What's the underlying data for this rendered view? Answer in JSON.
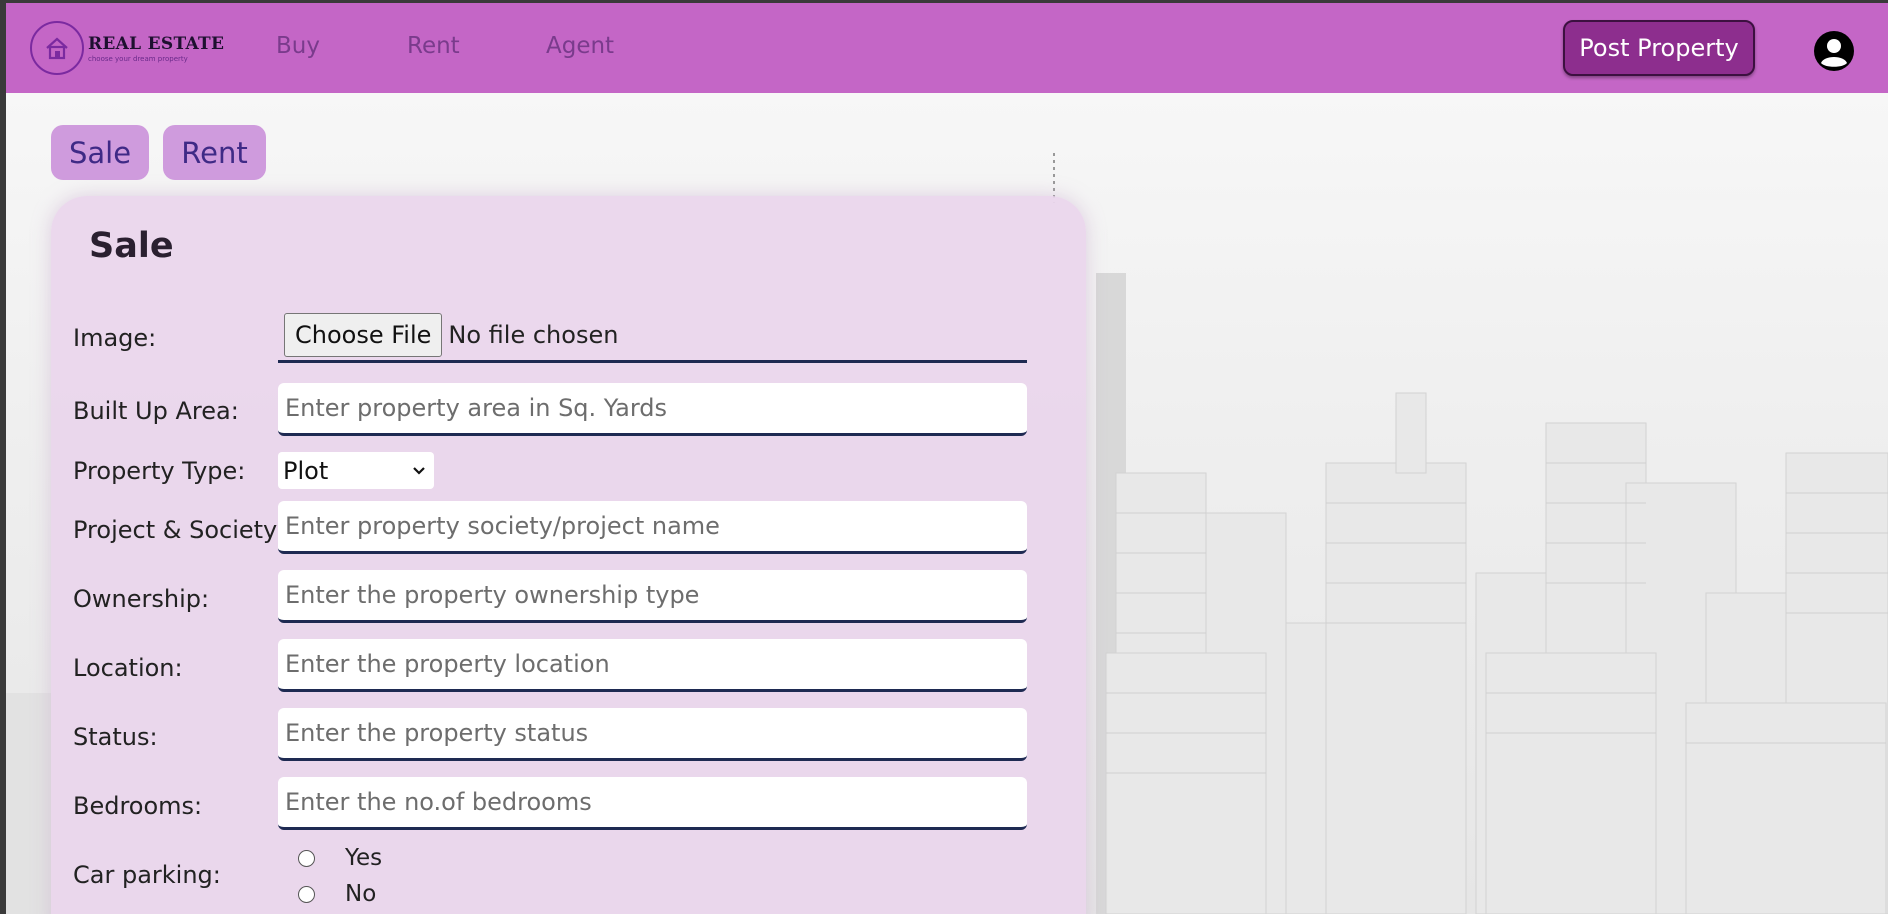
{
  "brand": {
    "title": "REAL ESTATE",
    "tagline": "choose your dream property",
    "logo_icon": "house-logo-icon"
  },
  "nav": {
    "links": [
      "Buy",
      "Rent",
      "Agent"
    ],
    "post_button": "Post Property",
    "user_icon": "account-circle-icon"
  },
  "tabs": {
    "sale": "Sale",
    "rent": "Rent"
  },
  "form": {
    "title": "Sale",
    "image": {
      "label": "Image:",
      "button": "Choose File",
      "status": "No file chosen"
    },
    "area": {
      "label": "Built Up Area:",
      "placeholder": "Enter property area in Sq. Yards"
    },
    "property_type": {
      "label": "Property Type:",
      "value": "Plot"
    },
    "project": {
      "label": "Project & Society:",
      "placeholder": "Enter property society/project name"
    },
    "ownership": {
      "label": "Ownership:",
      "placeholder": "Enter the property ownership type"
    },
    "location": {
      "label": "Location:",
      "placeholder": "Enter the property location"
    },
    "status": {
      "label": "Status:",
      "placeholder": "Enter the property status"
    },
    "bedrooms": {
      "label": "Bedrooms:",
      "placeholder": "Enter the no.of bedrooms"
    },
    "car_parking": {
      "label": "Car parking:",
      "options": [
        "Yes",
        "No"
      ]
    }
  },
  "colors": {
    "navbar": "#c466c6",
    "post_button": "#8d2e8e",
    "toggle": "#cf9bdd",
    "card": "#ead6ec",
    "field_border": "#1e2a52"
  }
}
